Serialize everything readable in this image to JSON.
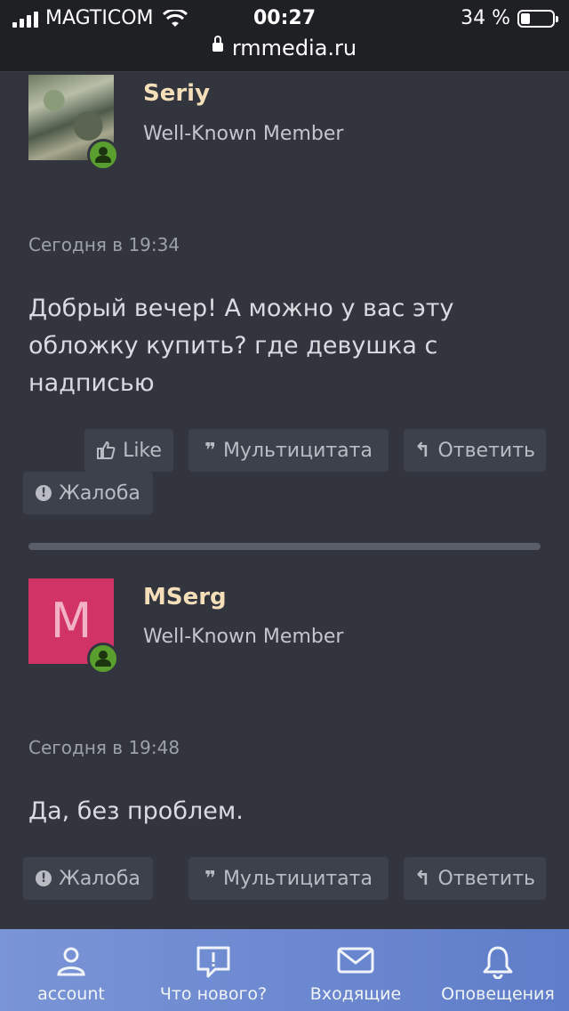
{
  "status_bar": {
    "carrier": "MAGTICOM",
    "time": "00:27",
    "battery": "34 %",
    "url": "rmmedia.ru"
  },
  "posts": [
    {
      "username": "Seriy",
      "user_title": "Well-Known Member",
      "date": "Сегодня в 19:34",
      "message": "Добрый вечер! А можно у вас эту обложку купить? где девушка с надписью",
      "actions": {
        "like": "Like",
        "multiquote": "Мультицитата",
        "reply": "Ответить",
        "report": "Жалоба"
      }
    },
    {
      "username": "MSerg",
      "avatar_letter": "M",
      "user_title": "Well-Known Member",
      "date": "Сегодня в 19:48",
      "message": "Да, без проблем.",
      "actions": {
        "report": "Жалоба",
        "multiquote": "Мультицитата",
        "reply": "Ответить"
      }
    }
  ],
  "tabbar": {
    "account": "account",
    "whats_new": "Что нового?",
    "inbox": "Входящие",
    "alerts": "Оповещения"
  },
  "colors": {
    "background": "#32353e",
    "username": "#f5dfb9",
    "avatar_m": "#d23367",
    "online": "#5a9e2f",
    "tabbar": "#6d89d0"
  },
  "icons": [
    "signal-icon",
    "wifi-icon",
    "lock-icon",
    "battery-icon",
    "thumbs-up-icon",
    "quote-icon",
    "reply-icon",
    "report-icon",
    "online-status-icon",
    "account-icon",
    "whats-new-icon",
    "inbox-icon",
    "bell-icon"
  ]
}
